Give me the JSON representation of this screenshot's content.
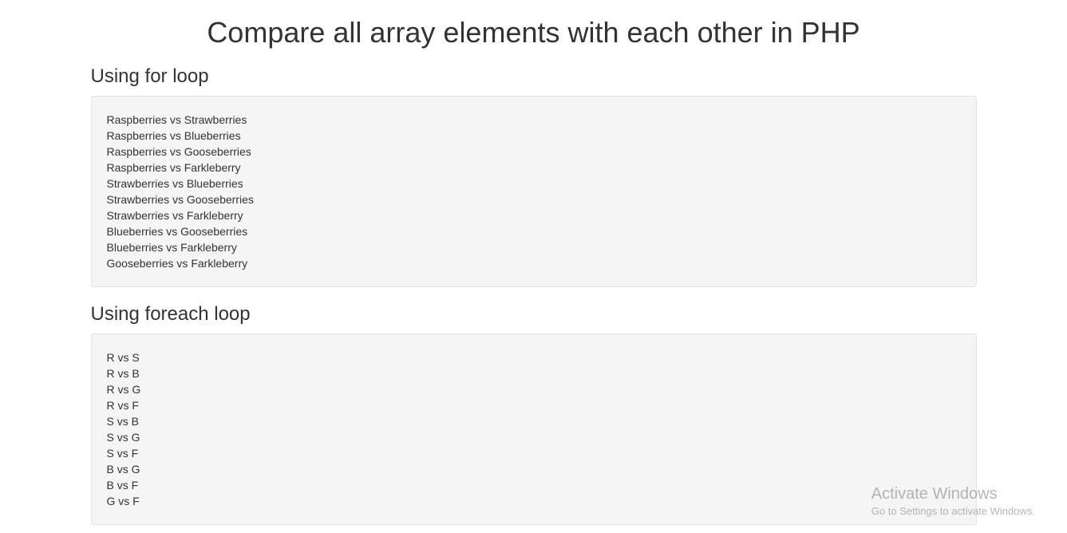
{
  "title": "Compare all array elements with each other in PHP",
  "sections": [
    {
      "heading": "Using for loop",
      "lines": [
        "Raspberries vs Strawberries",
        "Raspberries vs Blueberries",
        "Raspberries vs Gooseberries",
        "Raspberries vs Farkleberry",
        "Strawberries vs Blueberries",
        "Strawberries vs Gooseberries",
        "Strawberries vs Farkleberry",
        "Blueberries vs Gooseberries",
        "Blueberries vs Farkleberry",
        "Gooseberries vs Farkleberry"
      ]
    },
    {
      "heading": "Using foreach loop",
      "lines": [
        "R vs S",
        "R vs B",
        "R vs G",
        "R vs F",
        "S vs B",
        "S vs G",
        "S vs F",
        "B vs G",
        "B vs F",
        "G vs F"
      ]
    }
  ],
  "watermark": {
    "title": "Activate Windows",
    "subtitle": "Go to Settings to activate Windows."
  }
}
